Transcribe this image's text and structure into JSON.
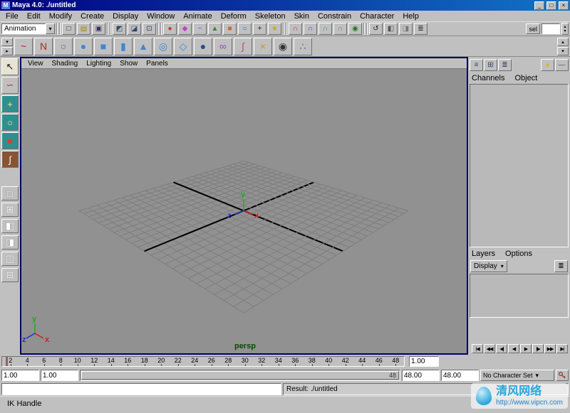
{
  "window": {
    "title": "Maya 4.0: ./untitled",
    "logo_glyph": "M",
    "minimize_glyph": "_",
    "maximize_glyph": "□",
    "close_glyph": "×"
  },
  "glyphs": {
    "chevron_down": "▾",
    "chevron_up": "▴",
    "chevron_right": "▸"
  },
  "menu_bar": {
    "items": [
      "File",
      "Edit",
      "Modify",
      "Create",
      "Display",
      "Window",
      "Animate",
      "Deform",
      "Skeleton",
      "Skin",
      "Constrain",
      "Character",
      "Help"
    ]
  },
  "status_line": {
    "menu_selector": "Animation",
    "file_icons": [
      {
        "name": "new-scene-icon",
        "glyph": "□",
        "color": "#222222"
      },
      {
        "name": "open-scene-icon",
        "glyph": "▤",
        "color": "#a8851a"
      },
      {
        "name": "save-scene-icon",
        "glyph": "▣",
        "color": "#333366"
      }
    ],
    "mode_icons": [
      {
        "name": "select-by-hierarchy-icon",
        "glyph": "◩",
        "color": "#334466"
      },
      {
        "name": "select-by-object-icon",
        "glyph": "◪",
        "color": "#334466"
      },
      {
        "name": "select-by-component-icon",
        "glyph": "⊡",
        "color": "#334466"
      }
    ],
    "mask_icons": [
      {
        "name": "mask-points-icon",
        "glyph": "●",
        "color": "#cc3333"
      },
      {
        "name": "mask-handles-icon",
        "glyph": "◆",
        "color": "#bb44bb"
      },
      {
        "name": "mask-curves-icon",
        "glyph": "~",
        "color": "#3355cc"
      },
      {
        "name": "mask-surfaces-icon",
        "glyph": "▲",
        "color": "#338833"
      },
      {
        "name": "mask-deformations-icon",
        "glyph": "■",
        "color": "#cc6633"
      },
      {
        "name": "mask-joints-icon",
        "glyph": "○",
        "color": "#0066cc"
      },
      {
        "name": "mask-markers-icon",
        "glyph": "+",
        "color": "#222222"
      },
      {
        "name": "mask-misc-icon",
        "glyph": "★",
        "color": "#ccaa00"
      }
    ],
    "snap_icons": [
      {
        "name": "snap-to-grid-icon",
        "glyph": "∩",
        "color": "#cc3333"
      },
      {
        "name": "snap-to-curve-icon",
        "glyph": "∩",
        "color": "#3344cc"
      },
      {
        "name": "snap-to-point-icon",
        "glyph": "∩",
        "color": "#33aa33"
      },
      {
        "name": "snap-to-plane-icon",
        "glyph": "∩",
        "color": "#777777"
      },
      {
        "name": "make-live-icon",
        "glyph": "◉",
        "color": "#227722"
      }
    ],
    "render_icons": [
      {
        "name": "construction-history-icon",
        "glyph": "↺",
        "color": "#222222"
      },
      {
        "name": "render-frame-icon",
        "glyph": "◧",
        "color": "#555555"
      },
      {
        "name": "ipr-render-icon",
        "glyph": "◨",
        "color": "#777777"
      },
      {
        "name": "render-globals-icon",
        "glyph": "≣",
        "color": "#333333"
      }
    ],
    "quick_select_label": "sel"
  },
  "shelf": {
    "items": [
      {
        "name": "cv-curve-tool-icon",
        "glyph": "~",
        "color": "#bb2222"
      },
      {
        "name": "ep-curve-tool-icon",
        "glyph": "N",
        "color": "#bb2222"
      },
      {
        "name": "nurbs-circle-icon",
        "glyph": "○",
        "color": "#2e6fbe"
      },
      {
        "name": "nurbs-sphere-icon",
        "glyph": "●",
        "color": "#3f86d2"
      },
      {
        "name": "nurbs-cube-icon",
        "glyph": "■",
        "color": "#3f86d2"
      },
      {
        "name": "nurbs-cylinder-icon",
        "glyph": "▮",
        "color": "#3f86d2"
      },
      {
        "name": "nurbs-cone-icon",
        "glyph": "▲",
        "color": "#3f86d2"
      },
      {
        "name": "nurbs-torus-icon",
        "glyph": "◎",
        "color": "#3f86d2"
      },
      {
        "name": "nurbs-plane-icon",
        "glyph": "◇",
        "color": "#3f86d2"
      },
      {
        "name": "poly-sphere-icon",
        "glyph": "●",
        "color": "#1f4f8f"
      },
      {
        "name": "joint-tool-icon",
        "glyph": "∞",
        "color": "#9944bb"
      },
      {
        "name": "ik-handle-tool-icon",
        "glyph": "∫",
        "color": "#bb4499"
      },
      {
        "name": "lattice-tool-icon",
        "glyph": "×",
        "color": "#cc9900"
      },
      {
        "name": "camera-icon",
        "glyph": "◉",
        "color": "#333333"
      },
      {
        "name": "particle-tool-icon",
        "glyph": "∴",
        "color": "#3355cc"
      }
    ]
  },
  "toolbox": {
    "tools": [
      {
        "name": "select-tool-button",
        "glyph": "↖",
        "color": "#111111",
        "bg": "#e7e3d3"
      },
      {
        "name": "lasso-select-tool-button",
        "glyph": "∽",
        "color": "#bb2222",
        "bg": "#c0c0c0"
      },
      {
        "name": "move-tool-button",
        "glyph": "+",
        "color": "#ffee88",
        "bg": "#2f8f8f"
      },
      {
        "name": "rotate-tool-button",
        "glyph": "○",
        "color": "#ffee88",
        "bg": "#2f8f8f"
      },
      {
        "name": "scale-tool-button",
        "glyph": "■",
        "color": "#cc4444",
        "bg": "#2f8f8f"
      },
      {
        "name": "last-tool-ik-handle-button",
        "glyph": "∫",
        "color": "#ffffff",
        "bg": "#885533"
      }
    ],
    "layouts": [
      {
        "name": "layout-single-pane-button",
        "glyph": "□"
      },
      {
        "name": "layout-four-pane-button",
        "glyph": "⊞"
      },
      {
        "name": "layout-two-pane-left-button",
        "glyph": "◧"
      },
      {
        "name": "layout-two-pane-right-button",
        "glyph": "◨"
      },
      {
        "name": "layout-two-pane-split-button",
        "glyph": "◫"
      },
      {
        "name": "layout-two-pane-horizontal-button",
        "glyph": "⊟"
      }
    ]
  },
  "viewport": {
    "menus": [
      "View",
      "Shading",
      "Lighting",
      "Show",
      "Panels"
    ],
    "camera_label": "persp",
    "axis": {
      "x": "x",
      "y": "y",
      "z": "z"
    }
  },
  "right_panel": {
    "icons_left": [
      {
        "name": "align-rows-icon",
        "glyph": "≡",
        "color": "#334466"
      },
      {
        "name": "grid-view-icon",
        "glyph": "⊞",
        "color": "#334466"
      },
      {
        "name": "list-view-icon",
        "glyph": "≣",
        "color": "#334466"
      }
    ],
    "icons_right": [
      {
        "name": "ball-icon",
        "glyph": "●",
        "color": "#d8b830"
      },
      {
        "name": "dash-icon",
        "glyph": "—",
        "color": "#555555"
      }
    ]
  },
  "channel_box": {
    "menus": [
      "Channels",
      "Object"
    ]
  },
  "layers": {
    "menus": [
      "Layers",
      "Options"
    ],
    "display_label": "Display",
    "stack_icon_glyph": "≣"
  },
  "playback": {
    "buttons": [
      {
        "name": "go-to-start-button",
        "glyph": "|◀"
      },
      {
        "name": "step-back-key-button",
        "glyph": "◀◀"
      },
      {
        "name": "step-back-frame-button",
        "glyph": "◀|"
      },
      {
        "name": "play-backward-button",
        "glyph": "◀"
      },
      {
        "name": "play-forward-button",
        "glyph": "▶"
      },
      {
        "name": "step-forward-frame-button",
        "glyph": "|▶"
      },
      {
        "name": "step-forward-key-button",
        "glyph": "▶▶"
      },
      {
        "name": "go-to-end-button",
        "glyph": "▶|"
      }
    ]
  },
  "time_slider": {
    "ticks": [
      "2",
      "4",
      "6",
      "8",
      "10",
      "12",
      "14",
      "16",
      "18",
      "20",
      "22",
      "24",
      "26",
      "28",
      "30",
      "32",
      "34",
      "36",
      "38",
      "40",
      "42",
      "44",
      "46",
      "48"
    ],
    "current": "1.00"
  },
  "range_slider": {
    "animation_start": "1.00",
    "playback_start": "1.00",
    "inner_end_label": "48",
    "playback_end": "48.00",
    "animation_end": "48.00",
    "character_set": "No Character Set"
  },
  "command_line": {
    "input_value": "",
    "result": "Result: ./untitled"
  },
  "help_line": {
    "text": "IK Handle"
  },
  "watermark": {
    "site_name": "清风网络",
    "site_url": "http://www.vipcn.com"
  },
  "colors": {
    "chrome": "#c0c0c0",
    "titlebar_left": "#000080",
    "titlebar_right": "#1274c6",
    "viewport_bg": "#919191",
    "grid_line": "#7e7e7e",
    "grid_axis": "#000000",
    "axis_x": "#cc2222",
    "axis_y": "#22aa22",
    "axis_z": "#2233cc",
    "persp_label": "#004d00",
    "viewport_border": "#000066",
    "watermark_blue": "#2aa7dc"
  }
}
